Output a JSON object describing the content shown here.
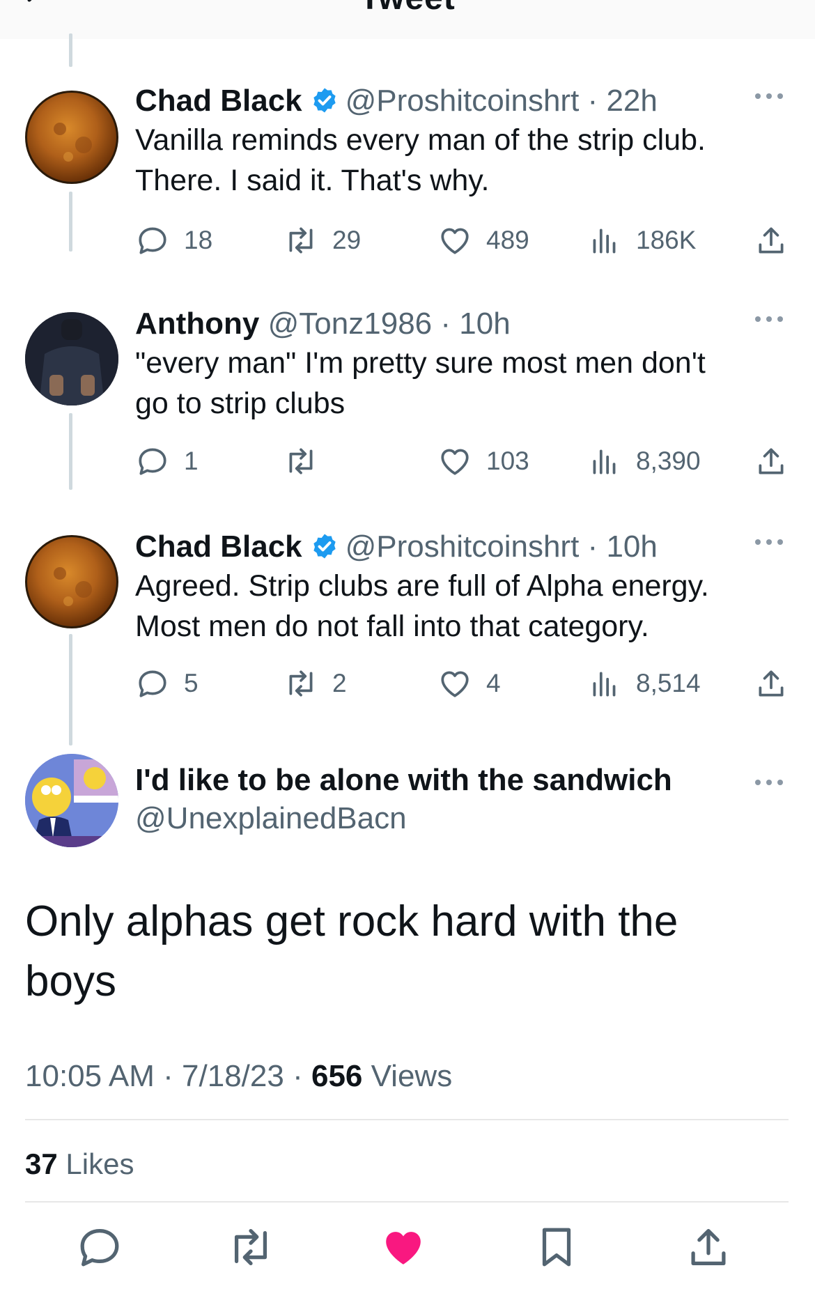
{
  "header": {
    "title": "Tweet"
  },
  "thread": [
    {
      "name": "Chad Black",
      "verified": true,
      "handle": "@Proshitcoinshrt",
      "dot": "·",
      "time": "22h",
      "text_lines": [
        "Vanilla reminds every man of the strip club.",
        "There. I said it. That's why."
      ],
      "replies": "18",
      "retweets": "29",
      "likes": "489",
      "views": "186K",
      "avatar": "sun-avatar"
    },
    {
      "name": "Anthony",
      "verified": false,
      "handle": "@Tonz1986",
      "dot": "·",
      "time": "10h",
      "text_lines": [
        "\"every man\" I'm pretty sure most men don't",
        "go to strip clubs"
      ],
      "replies": "1",
      "retweets": "",
      "likes": "103",
      "views": "8,390",
      "avatar": "man-avatar"
    },
    {
      "name": "Chad Black",
      "verified": true,
      "handle": "@Proshitcoinshrt",
      "dot": "·",
      "time": "10h",
      "text_lines": [
        "Agreed. Strip clubs are full of Alpha energy.",
        "Most men do not fall into that category."
      ],
      "replies": "5",
      "retweets": "2",
      "likes": "4",
      "views": "8,514",
      "avatar": "sun-avatar"
    }
  ],
  "main_tweet": {
    "name": "I'd like to be alone with the sandwich",
    "handle": "@UnexplainedBacn",
    "text_lines": [
      "Only alphas get rock hard with the",
      "boys"
    ],
    "time": "10:05 AM",
    "date": "7/18/23",
    "dot": "·",
    "views_count": "656",
    "views_label": "Views",
    "likes_count": "37",
    "likes_label": "Likes"
  },
  "colors": {
    "verified": "#1d9bf0",
    "liked": "#f91880",
    "muted": "#536471",
    "text": "#0f1419"
  }
}
